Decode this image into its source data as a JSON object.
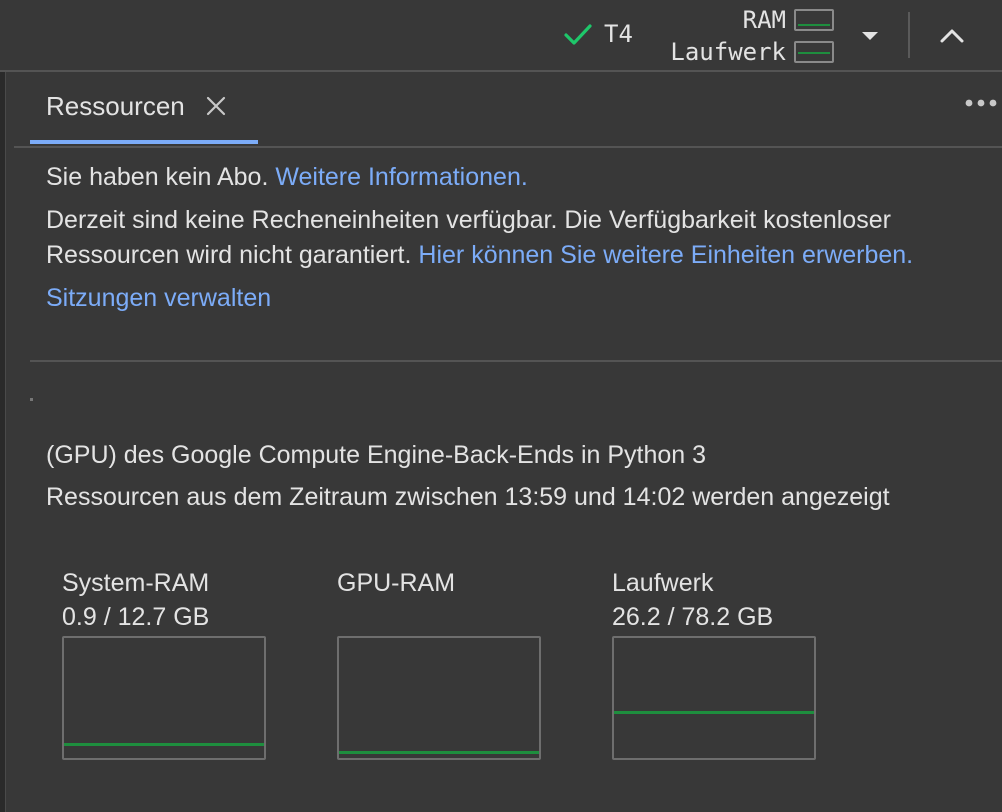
{
  "header": {
    "runtime": "T4",
    "meters": [
      {
        "label": "RAM",
        "fraction": 0.07
      },
      {
        "label": "Laufwerk",
        "fraction": 0.34
      }
    ]
  },
  "tab": {
    "label": "Ressourcen"
  },
  "notice": {
    "no_subscription": "Sie haben kein Abo.",
    "more_info_link": "Weitere Informationen.",
    "compute_text": "Derzeit sind keine Recheneinheiten verfügbar. Die Verfügbarkeit kostenloser Ressourcen wird nicht garantiert.",
    "buy_link": "Hier können Sie weitere Einheiten erwerben.",
    "manage_sessions": "Sitzungen verwalten"
  },
  "description": {
    "line1": "(GPU) des Google Compute Engine-Back-Ends in Python 3",
    "line2": "Ressourcen aus dem Zeitraum zwischen 13:59 und 14:02 werden angezeigt"
  },
  "gauges": [
    {
      "title": "System-RAM",
      "value": "0.9 / 12.7 GB",
      "fraction": 0.07
    },
    {
      "title": "GPU-RAM",
      "value": "",
      "fraction": 0.0
    },
    {
      "title": "Laufwerk",
      "value": "26.2 / 78.2 GB",
      "fraction": 0.34
    }
  ],
  "colors": {
    "accent": "#7cacf8",
    "success": "#1e8e3e",
    "check": "#1ec76a",
    "background": "#383838"
  }
}
